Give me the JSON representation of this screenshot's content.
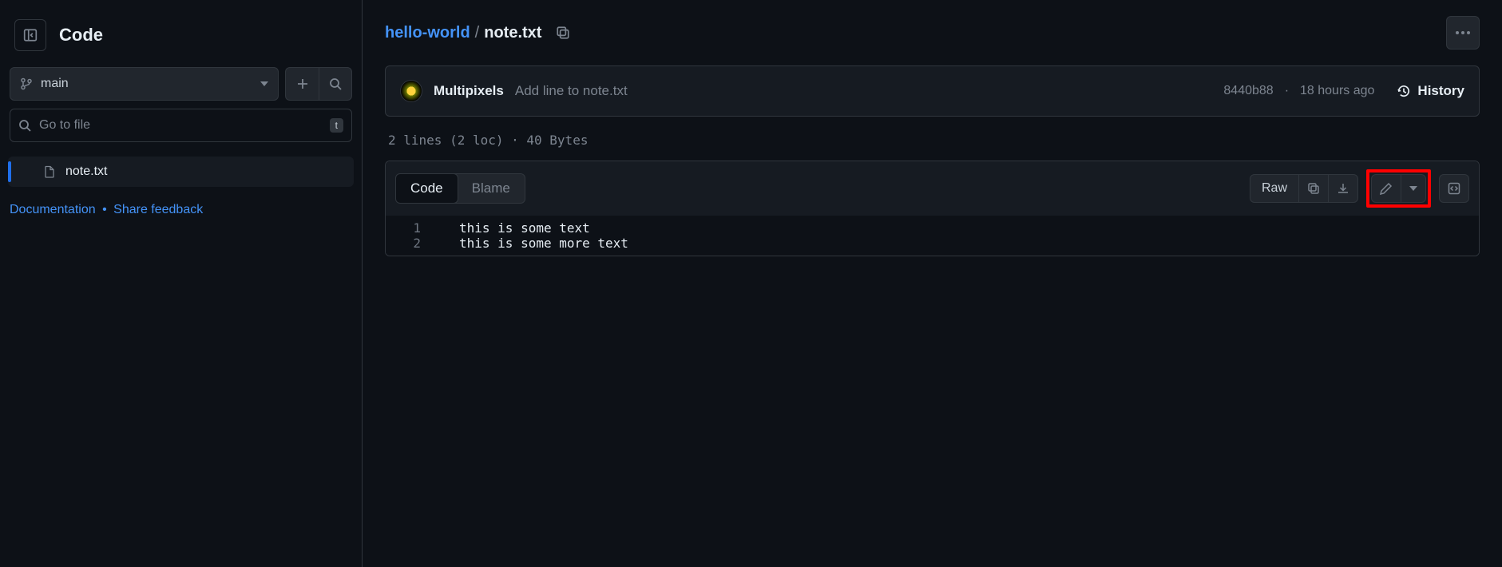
{
  "sidebar": {
    "title": "Code",
    "branch": "main",
    "search_placeholder": "Go to file",
    "search_key": "t",
    "files": [
      {
        "name": "note.txt"
      }
    ],
    "doc_link": "Documentation",
    "feedback_link": "Share feedback"
  },
  "breadcrumb": {
    "repo": "hello-world",
    "file": "note.txt"
  },
  "commit": {
    "author": "Multipixels",
    "message": "Add line to note.txt",
    "sha": "8440b88",
    "relative_time": "18 hours ago",
    "history_label": "History"
  },
  "file_stats": "2 lines (2 loc) · 40 Bytes",
  "tabs": {
    "code": "Code",
    "blame": "Blame"
  },
  "toolbar": {
    "raw": "Raw"
  },
  "code_lines": [
    "this is some text",
    "this is some more text"
  ]
}
